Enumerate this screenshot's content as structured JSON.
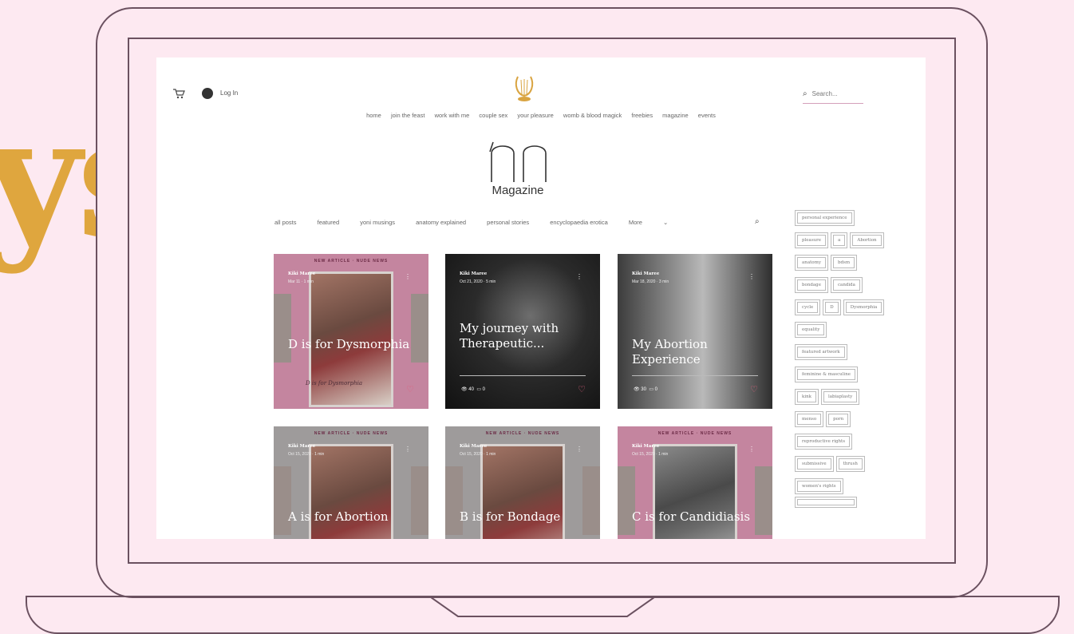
{
  "background_text": "ys",
  "colors": {
    "background": "#fde9f1",
    "accent_gold": "#dfa63e",
    "outline": "#6b5160",
    "card_pink": "#c4859f",
    "heart": "#e0607e"
  },
  "header": {
    "login_label": "Log In",
    "search_placeholder": "Search...",
    "nav_items": [
      "home",
      "join the feast",
      "work with me",
      "couple sex",
      "your pleasure",
      "womb & blood magick",
      "freebies",
      "magazine",
      "events"
    ]
  },
  "magazine": {
    "title": "Magazine",
    "categories": [
      "all posts",
      "featured",
      "yoni musings",
      "anatomy explained",
      "personal stories",
      "encyclopaedia erotica",
      "More"
    ]
  },
  "posts": [
    {
      "banner": "NEW ARTICLE · NUDE NEWS",
      "author": "Kiki Maree",
      "date": "Mar 11 · 1 min",
      "title": "D is for Dysmorphia",
      "script": "D is for Dysmorphia",
      "views": "",
      "comments": ""
    },
    {
      "banner": "",
      "author": "Kiki Maree",
      "date": "Oct 21, 2020 · 5 min",
      "title": "My journey with Therapeutic...",
      "views": "40",
      "comments": "0"
    },
    {
      "banner": "",
      "author": "Kiki Maree",
      "date": "Mar 18, 2020 · 3 min",
      "title": "My Abortion Experience",
      "views": "30",
      "comments": "0"
    },
    {
      "banner": "NEW ARTICLE · NUDE NEWS",
      "author": "Kiki Maree",
      "date": "Oct 15, 2020 · 1 min",
      "title": "A is for Abortion"
    },
    {
      "banner": "NEW ARTICLE · NUDE NEWS",
      "author": "Kiki Maree",
      "date": "Oct 15, 2020 · 1 min",
      "title": "B is for Bondage"
    },
    {
      "banner": "NEW ARTICLE · NUDE NEWS",
      "author": "Kiki Maree",
      "date": "Oct 15, 2020 · 1 min",
      "title": "C is for Candidiasis"
    }
  ],
  "tags": [
    "personal experience",
    "pleasure",
    "a",
    "Abortion",
    "anatomy",
    "bdsm",
    "bondage",
    "candida",
    "cycle",
    "D",
    "Dysmorphia",
    "equality",
    "featured artwork",
    "feminine & masculine",
    "kink",
    "labiaplasty",
    "menso",
    "porn",
    "reproductive rights",
    "submissive",
    "thrush",
    "women's rights",
    ""
  ]
}
